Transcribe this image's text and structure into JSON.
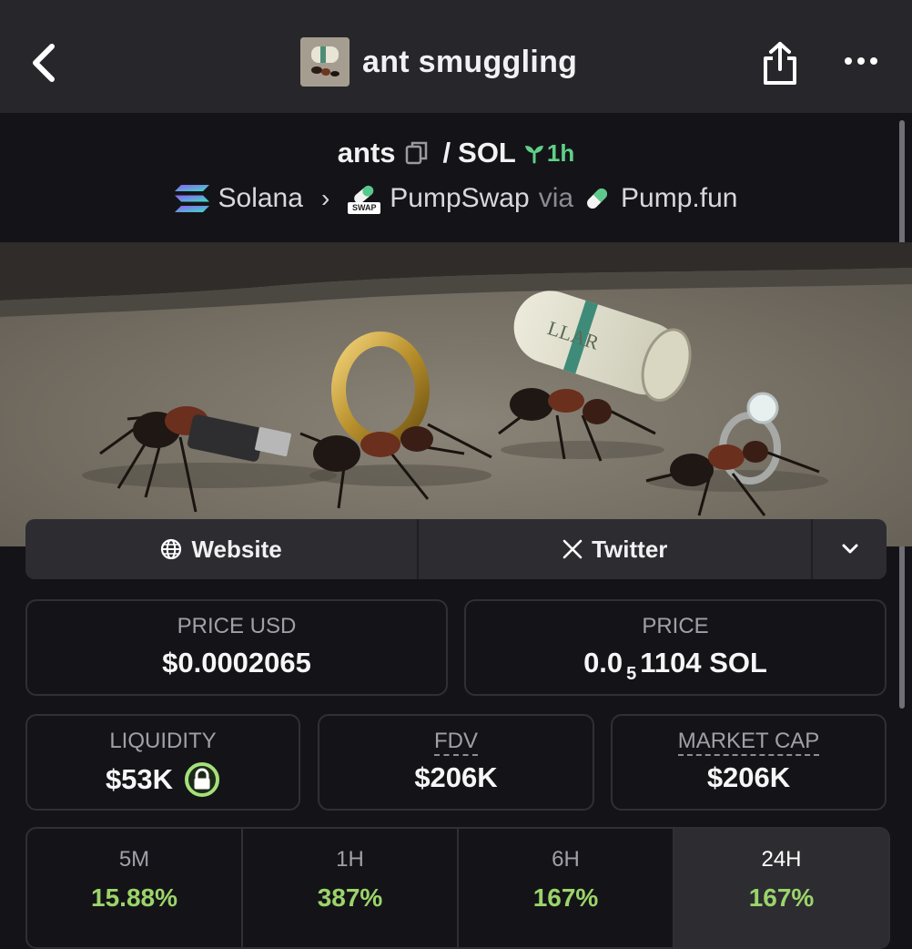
{
  "header": {
    "title": "ant smuggling",
    "back_icon": "chevron-left-icon",
    "share_icon": "share-icon",
    "more_icon": "more-horizontal-icon"
  },
  "pair": {
    "base": "ants",
    "separator": "/",
    "quote": "SOL",
    "age": "1h",
    "chain": "Solana",
    "dex": "PumpSwap",
    "dex_badge": "SWAP",
    "via_label": "via",
    "launchpad": "Pump.fun"
  },
  "links": {
    "website": "Website",
    "twitter": "Twitter"
  },
  "stats": {
    "price_usd": {
      "label": "PRICE USD",
      "value": "$0.0002065"
    },
    "price_native": {
      "label": "PRICE",
      "prefix": "0.0",
      "zeros": "5",
      "digits": "1104",
      "unit": "SOL"
    },
    "liquidity": {
      "label": "LIQUIDITY",
      "value": "$53K"
    },
    "fdv": {
      "label": "FDV",
      "value": "$206K"
    },
    "market_cap": {
      "label": "MARKET CAP",
      "value": "$206K"
    }
  },
  "timeframes": [
    {
      "label": "5M",
      "value": "15.88%"
    },
    {
      "label": "1H",
      "value": "387%"
    },
    {
      "label": "6H",
      "value": "167%"
    },
    {
      "label": "24H",
      "value": "167%"
    }
  ],
  "colors": {
    "positive": "#9bd46a",
    "age": "#5fd089",
    "lock": "#a4e07a"
  }
}
